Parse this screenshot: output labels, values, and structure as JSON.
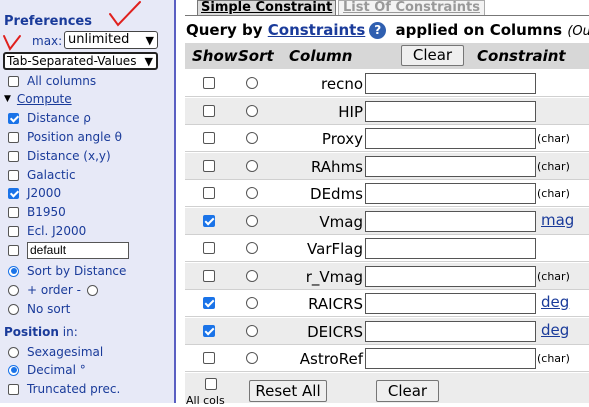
{
  "preferences": {
    "title": "Preferences",
    "max_label": "max:",
    "max_value": "unlimited",
    "format_value": "Tab-Separated-Values",
    "all_columns": {
      "label": "All columns",
      "checked": false
    },
    "compute_label": "Compute",
    "compute_items": [
      {
        "label": "Distance ρ",
        "checked": true
      },
      {
        "label": "Position angle θ",
        "checked": false
      },
      {
        "label": "Distance (x,y)",
        "checked": false
      },
      {
        "label": "Galactic",
        "checked": false
      },
      {
        "label": "J2000",
        "checked": true
      },
      {
        "label": "B1950",
        "checked": false
      },
      {
        "label": "Ecl. J2000",
        "checked": false
      }
    ],
    "default_value": "default",
    "sort_options": [
      {
        "label": "Sort by Distance",
        "selected": true
      },
      {
        "label": "+ order -",
        "selected": false
      },
      {
        "label": "No sort",
        "selected": false
      }
    ],
    "position_label": "Position",
    "position_suffix": " in:",
    "position_options": [
      {
        "label": "Sexagesimal",
        "selected": false
      },
      {
        "label": "Decimal °",
        "selected": true
      }
    ],
    "truncated": {
      "label": "Truncated prec.",
      "checked": false
    },
    "annotation_color": "#e0201e"
  },
  "tabs": {
    "simple": "Simple Constraint",
    "list": "List Of Constraints"
  },
  "query": {
    "prefix": "Query by ",
    "link": "Constraints",
    "suffix": " applied on Columns ",
    "output": "(Output"
  },
  "table_header": {
    "show": "Show",
    "sort": "Sort",
    "column": "Column",
    "clear": "Clear",
    "constraint": "Constraint"
  },
  "rows": [
    {
      "column": "recno",
      "show": false,
      "unit": "",
      "unit_link": false
    },
    {
      "column": "HIP",
      "show": false,
      "unit": "",
      "unit_link": false
    },
    {
      "column": "Proxy",
      "show": false,
      "unit": "(char)",
      "unit_link": false
    },
    {
      "column": "RAhms",
      "show": false,
      "unit": "(char)",
      "unit_link": false
    },
    {
      "column": "DEdms",
      "show": false,
      "unit": "(char)",
      "unit_link": false
    },
    {
      "column": "Vmag",
      "show": true,
      "unit": "mag",
      "unit_link": true
    },
    {
      "column": "VarFlag",
      "show": false,
      "unit": "",
      "unit_link": false
    },
    {
      "column": "r_Vmag",
      "show": false,
      "unit": "(char)",
      "unit_link": false
    },
    {
      "column": "RAICRS",
      "show": true,
      "unit": "deg",
      "unit_link": true
    },
    {
      "column": "DEICRS",
      "show": true,
      "unit": "deg",
      "unit_link": true
    },
    {
      "column": "AstroRef",
      "show": false,
      "unit": "(char)",
      "unit_link": false
    }
  ],
  "footer": {
    "all_label": "All cols",
    "reset_label": "Reset All",
    "clear_label": "Clear"
  }
}
